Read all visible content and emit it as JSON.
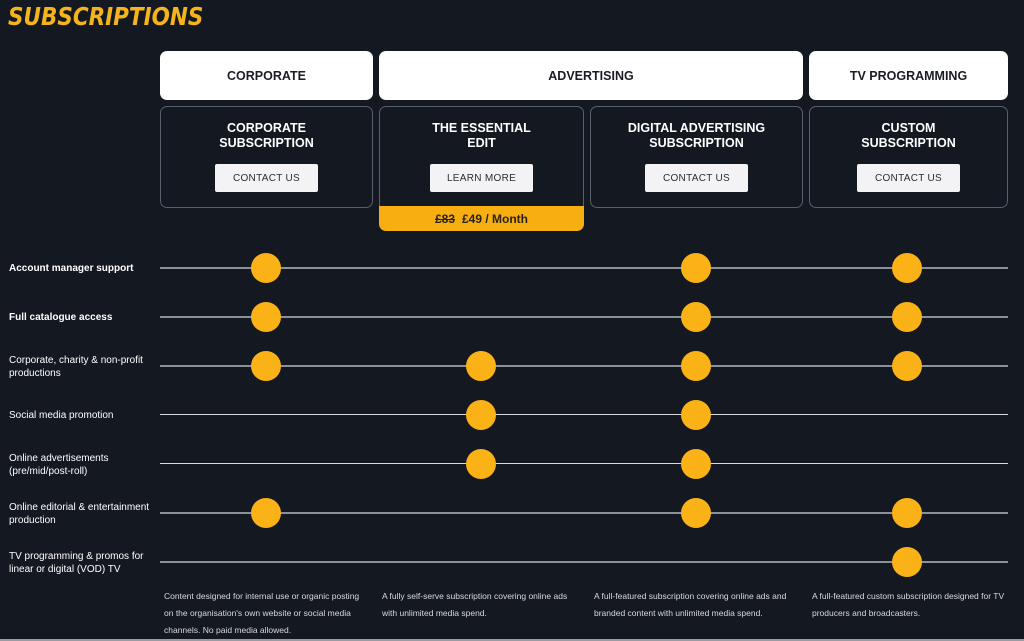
{
  "page": {
    "title": "SUBSCRIPTIONS"
  },
  "colors": {
    "background": "#131821",
    "accent": "#f7ae11",
    "dot": "#fbb216",
    "header_bg": "#ffffff"
  },
  "categories": [
    {
      "label": "CORPORATE"
    },
    {
      "label": "ADVERTISING"
    },
    {
      "label": "TV PROGRAMMING"
    }
  ],
  "plans": [
    {
      "name": "CORPORATE\nSUBSCRIPTION",
      "button": "CONTACT US",
      "description": "Content designed for internal use or organic posting on the organisation's own website or social media channels. No paid media allowed."
    },
    {
      "name": "THE ESSENTIAL\nEDIT",
      "button": "LEARN MORE",
      "price_old": "£83",
      "price_new": "£49 / Month",
      "description": "A fully self-serve subscription covering online ads with unlimited media spend."
    },
    {
      "name": "DIGITAL ADVERTISING\nSUBSCRIPTION",
      "button": "CONTACT US",
      "description": "A full-featured subscription covering online ads and branded content with unlimited media spend."
    },
    {
      "name": "CUSTOM\nSUBSCRIPTION",
      "button": "CONTACT US",
      "description": "A full-featured custom subscription designed for TV producers and broadcasters."
    }
  ],
  "features": [
    {
      "label": "Account manager support",
      "bold": true,
      "included": [
        true,
        false,
        true,
        true
      ]
    },
    {
      "label": "Full catalogue access",
      "bold": true,
      "included": [
        true,
        false,
        true,
        true
      ]
    },
    {
      "label": "Corporate, charity & non-profit productions",
      "bold": false,
      "included": [
        true,
        true,
        true,
        true
      ]
    },
    {
      "label": "Social media promotion",
      "bold": false,
      "included": [
        false,
        true,
        true,
        false
      ]
    },
    {
      "label": "Online advertisements (pre/mid/post-roll)",
      "bold": false,
      "included": [
        false,
        true,
        true,
        false
      ]
    },
    {
      "label": "Online editorial & entertainment production",
      "bold": false,
      "included": [
        true,
        false,
        true,
        true
      ]
    },
    {
      "label": "TV programming & promos for linear or digital (VOD) TV",
      "bold": false,
      "included": [
        false,
        false,
        false,
        true
      ]
    }
  ]
}
